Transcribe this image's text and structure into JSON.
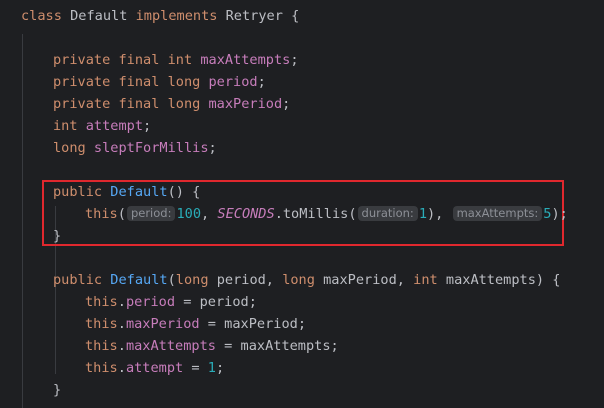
{
  "editor": {
    "lines": [
      {
        "kw": "class ",
        "name": "Default ",
        "kw2": "implements ",
        "rest": "Retryer {"
      },
      {
        "kw": "private final ",
        "type": "int ",
        "field": "maxAttempts",
        "end": ";"
      },
      {
        "kw": "private final ",
        "type": "long ",
        "field": "period",
        "end": ";"
      },
      {
        "kw": "private final ",
        "type": "long ",
        "field": "maxPeriod",
        "end": ";"
      },
      {
        "type": "int ",
        "field": "attempt",
        "end": ";"
      },
      {
        "type": "long ",
        "field": "sleptForMillis",
        "end": ";"
      }
    ],
    "ctor1": {
      "kw": "public ",
      "name": "Default",
      "sig": "() {",
      "this_kw": "this",
      "open": "(",
      "hint1": "period:",
      "val1": "100",
      "sep1": ", ",
      "const": "SECONDS",
      "method": ".toMillis(",
      "hint2": "duration:",
      "val2": "1",
      "sep2": "), ",
      "hint3": "maxAttempts:",
      "val3": "5",
      "close": ");",
      "brace": "}"
    },
    "ctor2": {
      "kw": "public ",
      "name": "Default",
      "p_open": "(",
      "t1": "long ",
      "p1": "period, ",
      "t2": "long ",
      "p2": "maxPeriod, ",
      "t3": "int ",
      "p3": "maxAttempts) {",
      "assign": [
        {
          "this": "this",
          "dot": ".",
          "field": "period",
          "rhs": " = period;"
        },
        {
          "this": "this",
          "dot": ".",
          "field": "maxPeriod",
          "rhs": " = maxPeriod;"
        },
        {
          "this": "this",
          "dot": ".",
          "field": "maxAttempts",
          "rhs": " = maxAttempts;"
        },
        {
          "this": "this",
          "dot": ".",
          "field": "attempt",
          "rhs_a": " = ",
          "num": "1",
          "rhs_b": ";"
        }
      ],
      "brace": "}"
    }
  },
  "colors": {
    "background": "#1e1f22",
    "keyword": "#cf8e6d",
    "field": "#c77dbb",
    "function": "#56a8f5",
    "number": "#2aacb8",
    "highlight_border": "#e0282e"
  }
}
